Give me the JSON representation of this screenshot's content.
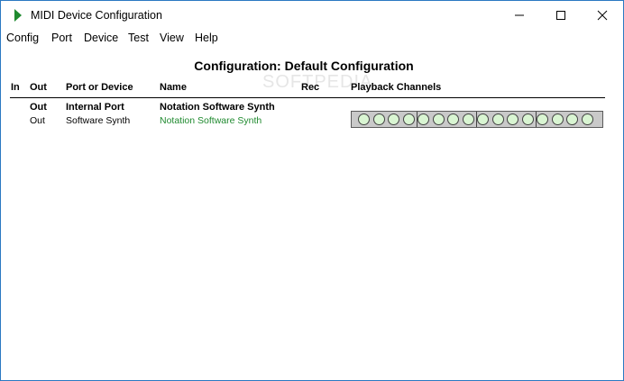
{
  "window": {
    "title": "MIDI Device Configuration",
    "icon": "midi-play-icon"
  },
  "menu": [
    "Config",
    "Port",
    "Device",
    "Test",
    "View",
    "Help"
  ],
  "heading": "Configuration: Default Configuration",
  "columns": {
    "in": "In",
    "out": "Out",
    "port_or_device": "Port or Device",
    "name": "Name",
    "rec": "Rec",
    "playback": "Playback Channels"
  },
  "rows": [
    {
      "out": "Out",
      "port": "Internal Port",
      "name": "Notation Software Synth"
    },
    {
      "out": "Out",
      "port": "Software Synth",
      "name": "Notation Software Synth"
    }
  ],
  "playback_channels": {
    "count": 16,
    "group_size": 4
  },
  "watermark": "SOFTPEDIA",
  "colors": {
    "device_name": "#1f8a2f",
    "channel_fill": "#d9f5d2",
    "channel_bar": "#c9c9c9",
    "icon": "#1f8a2f"
  }
}
